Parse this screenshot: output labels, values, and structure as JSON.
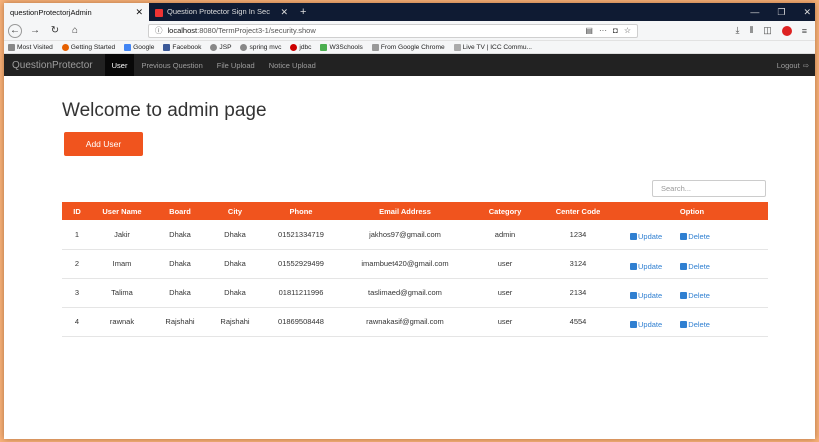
{
  "browser": {
    "tabs": [
      {
        "title": "questionProtectorjAdmin",
        "active": true
      },
      {
        "title": "Question Protector Sign In Sec",
        "active": false
      }
    ],
    "new_tab": "+",
    "url_prefix": "localhost",
    "url_rest": ":8080/TermProject3-1/security.show",
    "bookmarks": [
      {
        "label": "Most Visited",
        "color": "#888888"
      },
      {
        "label": "Getting Started",
        "color": "#e66000"
      },
      {
        "label": "Google",
        "color": "#4285f4"
      },
      {
        "label": "Facebook",
        "color": "#3b5998"
      },
      {
        "label": "JSP",
        "color": "#888888"
      },
      {
        "label": "spring mvc",
        "color": "#888888"
      },
      {
        "label": "jdbc",
        "color": "#cc0000"
      },
      {
        "label": "W3Schools",
        "color": "#4caf50"
      },
      {
        "label": "From Google Chrome",
        "color": "#999999"
      },
      {
        "label": "Live TV | ICC Commu...",
        "color": "#aaaaaa"
      }
    ]
  },
  "app": {
    "brand": "QuestionProtector",
    "nav": [
      "User",
      "Previous Question",
      "File Upload",
      "Notice Upload"
    ],
    "logout": "Logout"
  },
  "page": {
    "title": "Welcome to admin page",
    "add_user": "Add User",
    "search_placeholder": "Search..."
  },
  "table": {
    "headers": [
      "ID",
      "User Name",
      "Board",
      "City",
      "Phone",
      "Email Address",
      "Category",
      "Center Code",
      "Option"
    ],
    "update_label": "Update",
    "delete_label": "Delete",
    "rows": [
      [
        "1",
        "Jakir",
        "Dhaka",
        "Dhaka",
        "01521334719",
        "jakhos97@gmail.com",
        "admin",
        "1234"
      ],
      [
        "2",
        "Imam",
        "Dhaka",
        "Dhaka",
        "01552929499",
        "imambuet420@gmail.com",
        "user",
        "3124"
      ],
      [
        "3",
        "Talima",
        "Dhaka",
        "Dhaka",
        "01811211996",
        "taslimaed@gmail.com",
        "user",
        "2134"
      ],
      [
        "4",
        "rawnak",
        "Rajshahi",
        "Rajshahi",
        "01869508448",
        "rawnakasif@gmail.com",
        "user",
        "4554"
      ]
    ]
  },
  "colors": {
    "accent": "#f0541e",
    "link": "#2f7fd1",
    "navbar": "#222222"
  }
}
